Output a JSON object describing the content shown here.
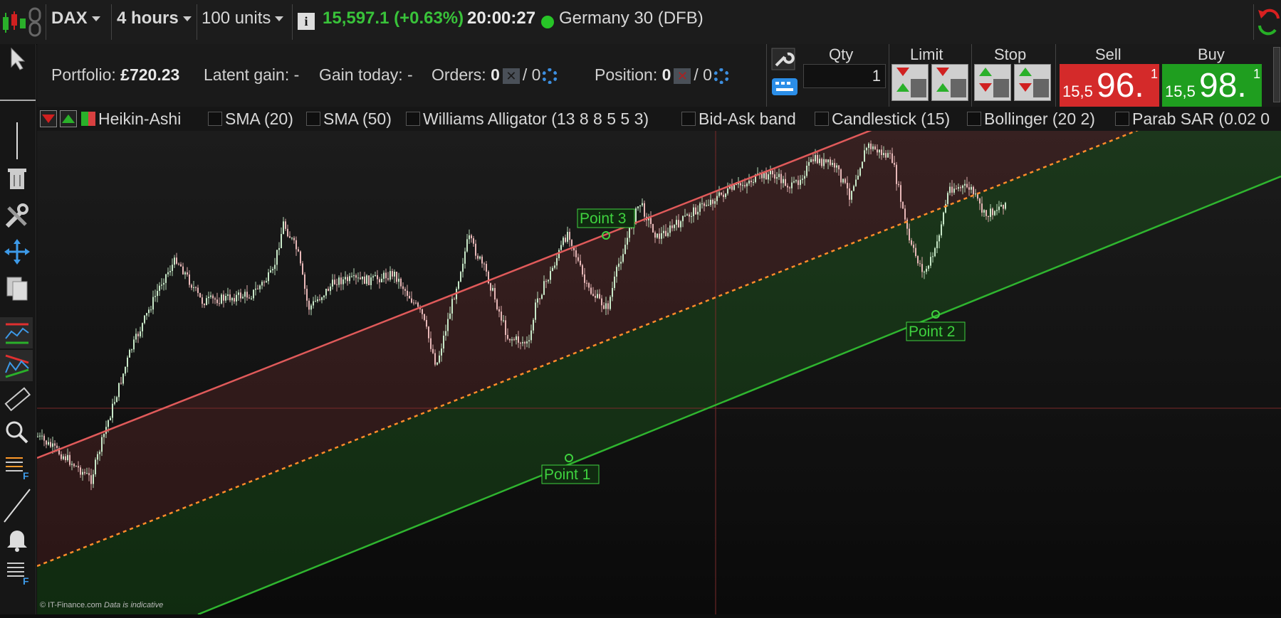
{
  "topbar": {
    "instrument": "DAX",
    "timeframe": "4 hours",
    "units": "100 units",
    "price_change": "15,597.1 (+0.63%)",
    "time": "20:00:27",
    "instrument_name": "Germany 30 (DFB)"
  },
  "portfolio": {
    "portfolio_label": "Portfolio:",
    "portfolio_value": "£720.23",
    "latent_label": "Latent gain:",
    "latent_value": "-",
    "gain_today_label": "Gain today:",
    "gain_today_value": "-",
    "orders_label": "Orders:",
    "orders_count": "0",
    "orders_total": "/ 0",
    "position_label": "Position:",
    "position_count": "0",
    "position_total": "/ 0"
  },
  "order_panel": {
    "qty_label": "Qty",
    "qty_value": "1",
    "limit_label": "Limit",
    "stop_label": "Stop",
    "sell_label": "Sell",
    "buy_label": "Buy",
    "sell_small": "15,5",
    "sell_big": "96.",
    "sell_sup": "1",
    "buy_small": "15,5",
    "buy_big": "98.",
    "buy_sup": "1",
    "sell_color": "#d42a2a",
    "buy_color": "#1f9e1f"
  },
  "indicators": [
    {
      "label": "Heikin-Ashi",
      "checked": true
    },
    {
      "label": "SMA (20)",
      "checked": false
    },
    {
      "label": "SMA (50)",
      "checked": false
    },
    {
      "label": "Williams Alligator (13 8 8 5 5 3)",
      "checked": false
    },
    {
      "label": "Bid-Ask band",
      "checked": false
    },
    {
      "label": "Candlestick (15)",
      "checked": false
    },
    {
      "label": "Bollinger (20 2)",
      "checked": false
    },
    {
      "label": "Parab SAR (0.02 0",
      "checked": false
    }
  ],
  "chart": {
    "point1": "Point 1",
    "point2": "Point 2",
    "point3": "Point 3",
    "copyright": "© IT-Finance.com",
    "disclaimer": "Data is indicative",
    "upper_line_color": "#e05a5a",
    "mid_line_color": "#ff8c2a",
    "lower_line_color": "#2fb52f"
  },
  "sidebar_icons": [
    "pointer-icon",
    "vertical-line-icon",
    "trash-icon",
    "tools-icon",
    "move-icon",
    "copy-icon",
    "trend-channel-icon",
    "triangle-channel-icon",
    "ruler-icon",
    "zoom-icon",
    "formula-icon",
    "line-icon",
    "alert-bell-icon",
    "list-icon"
  ]
}
